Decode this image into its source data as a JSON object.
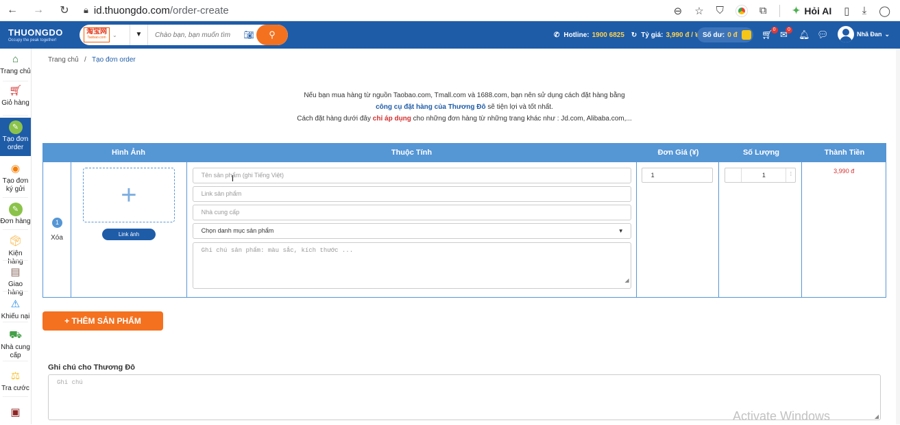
{
  "browser": {
    "url_host": "id.thuongdo.com",
    "url_path": "/order-create",
    "ai_label": "Hỏi AI"
  },
  "header": {
    "logo_name": "THUONGDO",
    "logo_tagline": "Occupy the peak together!",
    "source_name": "淘宝网",
    "source_sub": "Taobao.com",
    "search_placeholder": "Chào bạn, bạn muốn tìm",
    "hotline_label": "Hotline:",
    "hotline_value": "1900 6825",
    "rate_label": "Tỷ giá:",
    "rate_value": "3,990 đ / ¥",
    "balance_label": "Số dư:",
    "balance_value": "0 đ",
    "cart_badge": "0",
    "mail_badge": "0",
    "user_name": "Nhã Đan"
  },
  "sidebar": {
    "items": [
      {
        "label": "Trang chủ"
      },
      {
        "label": "Giỏ hàng"
      },
      {
        "label": "Tạo đơn order"
      },
      {
        "label": "Tạo đơn ký gửi"
      },
      {
        "label": "Đơn hàng"
      },
      {
        "label": "Kiện hàng"
      },
      {
        "label": "Giao hàng"
      },
      {
        "label": "Khiếu nại"
      },
      {
        "label": "Nhà cung cấp"
      },
      {
        "label": "Tra cước"
      }
    ]
  },
  "breadcrumb": {
    "home": "Trang chủ",
    "separator": "/",
    "current": "Tạo đơn order"
  },
  "notice": {
    "line1": "Nếu bạn mua hàng từ nguồn Taobao.com, Tmall.com và 1688.com, bạn nên sử dụng cách đặt hàng bằng",
    "line2_bold": "công cụ đặt hàng của Thương Đô",
    "line2_rest": " sẽ tiện lợi và tốt nhất.",
    "line3_pre": "Cách đặt hàng dưới đây ",
    "line3_bold": "chỉ áp dụng",
    "line3_post": " cho những đơn hàng từ những trang khác như : Jd.com, Alibaba.com,..."
  },
  "table": {
    "headers": [
      "Hình Ảnh",
      "Thuộc Tính",
      "Đơn Giá (¥)",
      "Số Lượng",
      "Thành Tiền"
    ],
    "row": {
      "index": "1",
      "delete_label": "Xóa",
      "link_button": "Link ảnh",
      "name_placeholder": "Tên sản phẩm (ghi Tiếng Việt)",
      "link_placeholder": "Link sản phẩm",
      "supplier_placeholder": "Nhà cung cấp",
      "category_selected": "Chọn danh mục sản phẩm",
      "note_placeholder": "Ghi chú sản phẩm: màu sắc, kích thước ...",
      "unit_price": "1",
      "quantity": "1",
      "total": "3,990 đ"
    }
  },
  "add_product_button": "+ THÊM SẢN PHẨM",
  "note": {
    "label": "Ghi chú cho Thương Đô",
    "placeholder": "Ghi chú"
  },
  "watermark": "Activate Windows"
}
